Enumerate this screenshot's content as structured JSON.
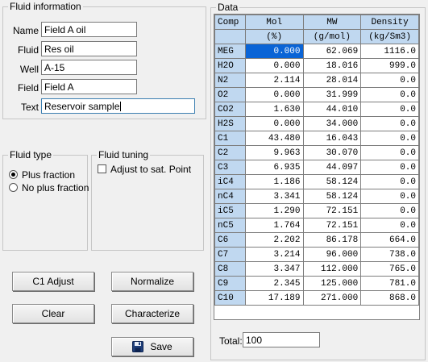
{
  "fluid_information": {
    "title": "Fluid information",
    "fields": [
      {
        "label": "Name",
        "value": "Field A oil"
      },
      {
        "label": "Fluid",
        "value": "Res oil"
      },
      {
        "label": "Well",
        "value": "A-15"
      },
      {
        "label": "Field",
        "value": "Field A"
      },
      {
        "label": "Text",
        "value": "Reservoir sample"
      }
    ]
  },
  "fluid_type": {
    "title": "Fluid type",
    "options": [
      {
        "label": "Plus fraction",
        "selected": true
      },
      {
        "label": "No plus fraction",
        "selected": false
      }
    ]
  },
  "fluid_tuning": {
    "title": "Fluid tuning",
    "adjust_label": "Adjust to sat. Point",
    "adjust_checked": false
  },
  "buttons": {
    "c1_adjust": "C1 Adjust",
    "normalize": "Normalize",
    "clear": "Clear",
    "characterize": "Characterize",
    "save": "Save"
  },
  "data": {
    "title": "Data",
    "columns": [
      "Comp",
      "Mol",
      "MW",
      "Density"
    ],
    "units": [
      "",
      "(%)",
      "(g/mol)",
      "(kg/Sm3)"
    ],
    "rows": [
      [
        "MEG",
        "0.000",
        "62.069",
        "1116.0"
      ],
      [
        "H2O",
        "0.000",
        "18.016",
        "999.0"
      ],
      [
        "N2",
        "2.114",
        "28.014",
        "0.0"
      ],
      [
        "O2",
        "0.000",
        "31.999",
        "0.0"
      ],
      [
        "CO2",
        "1.630",
        "44.010",
        "0.0"
      ],
      [
        "H2S",
        "0.000",
        "34.000",
        "0.0"
      ],
      [
        "C1",
        "43.480",
        "16.043",
        "0.0"
      ],
      [
        "C2",
        "9.963",
        "30.070",
        "0.0"
      ],
      [
        "C3",
        "6.935",
        "44.097",
        "0.0"
      ],
      [
        "iC4",
        "1.186",
        "58.124",
        "0.0"
      ],
      [
        "nC4",
        "3.341",
        "58.124",
        "0.0"
      ],
      [
        "iC5",
        "1.290",
        "72.151",
        "0.0"
      ],
      [
        "nC5",
        "1.764",
        "72.151",
        "0.0"
      ],
      [
        "C6",
        "2.202",
        "86.178",
        "664.0"
      ],
      [
        "C7",
        "3.214",
        "96.000",
        "738.0"
      ],
      [
        "C8",
        "3.347",
        "112.000",
        "765.0"
      ],
      [
        "C9",
        "2.345",
        "125.000",
        "781.0"
      ],
      [
        "C10",
        "17.189",
        "271.000",
        "868.0"
      ]
    ],
    "total_label": "Total:",
    "total_value": "100"
  }
}
